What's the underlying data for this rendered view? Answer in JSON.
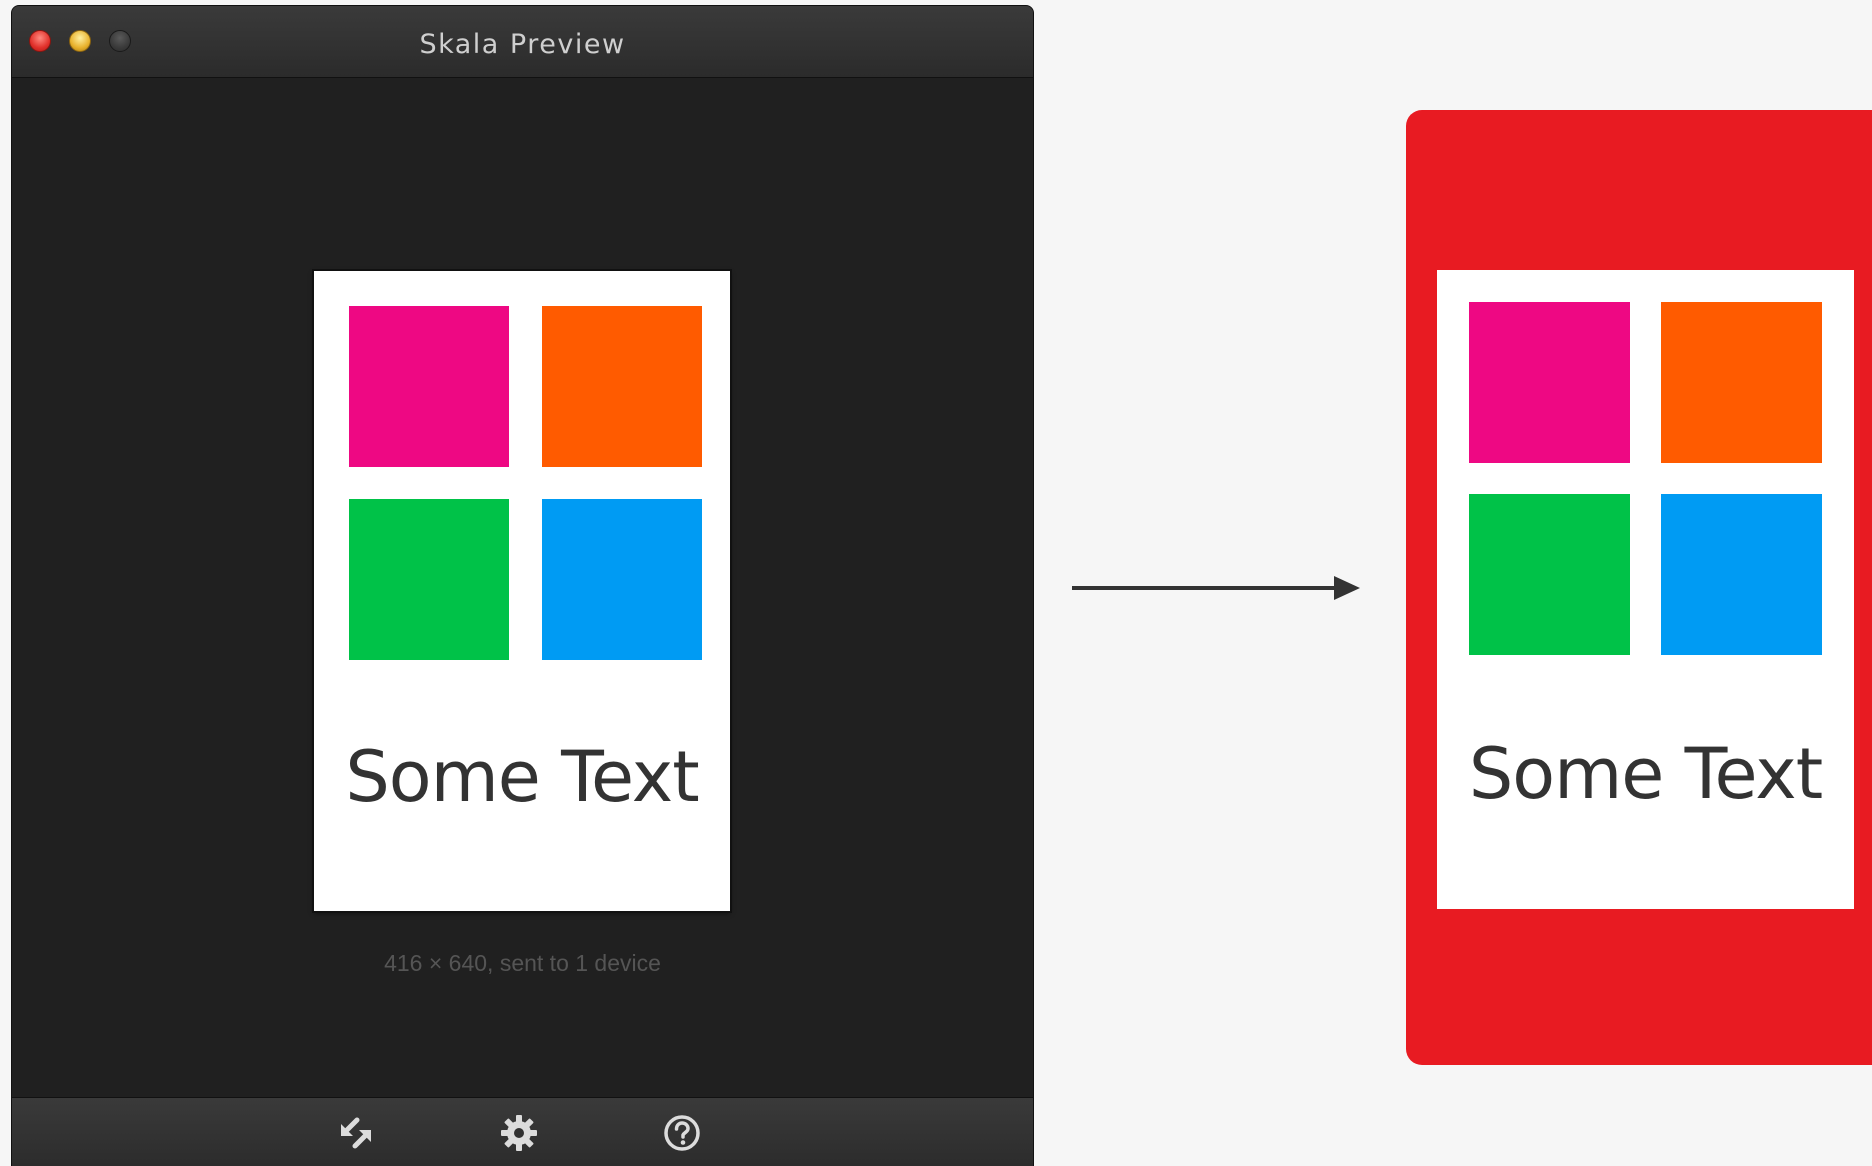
{
  "window": {
    "title": "Skala Preview"
  },
  "preview": {
    "caption": "416 × 640, sent to 1 device",
    "text": "Some Text",
    "colors": {
      "pink": "#ee0883",
      "orange": "#ff5b00",
      "green": "#00c248",
      "blue": "#009bf3"
    }
  },
  "toolbar": {
    "icons": [
      "sync-arrows-icon",
      "gear-icon",
      "help-icon"
    ]
  },
  "device": {
    "frame_color": "#e81b22",
    "screen_text": "Some Text"
  }
}
